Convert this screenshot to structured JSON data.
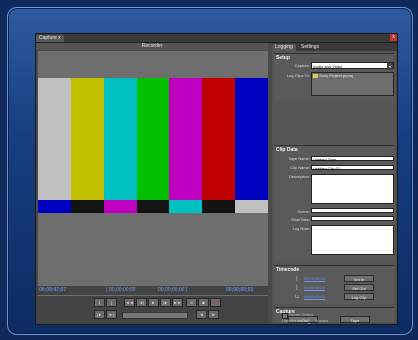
{
  "window": {
    "close_glyph": "x"
  },
  "tabs": {
    "capture_label": "Capture",
    "capture_close": "x"
  },
  "monitor": {
    "title": "Recorder",
    "color_bars_top": [
      "#c0c0c0",
      "#c0c000",
      "#00c0c0",
      "#00c000",
      "#c000c0",
      "#c00000",
      "#0000c0"
    ],
    "color_bars_mid": [
      "#0000c0",
      "#131313",
      "#c000c0",
      "#131313",
      "#00c0c0",
      "#131313",
      "#c0c0c0"
    ],
    "color_bars_low": [
      "#1f1150",
      "#ffffff",
      "#0c1f44",
      "#131313",
      "#131313",
      "#131313",
      "#131313"
    ]
  },
  "timecodes": {
    "current": "00;00;47;07",
    "in": "{ 00;00;00;00",
    "out": "00;00;00;00 }",
    "duration": "00;00;00;01"
  },
  "transport": {
    "row1": [
      "{",
      "}",
      "◄◄",
      "◄|",
      "►",
      "|►",
      "►►",
      "II",
      "■",
      "●"
    ],
    "row2": [
      "{►",
      "►}",
      "◄",
      "►"
    ]
  },
  "logging": {
    "tab_logging": "Logging",
    "tab_settings": "Settings",
    "setup": {
      "header": "Setup",
      "capture_label": "Capture:",
      "capture_value": "Audio and Video",
      "log_clips_label": "Log Clips To:",
      "log_clips_value": "Sony Project.prproj"
    },
    "clip_data": {
      "header": "Clip Data",
      "tape_name_label": "Tape Name:",
      "tape_name_value": "Untitled Tape",
      "clip_name_label": "Clip Name:",
      "clip_name_value": "Untitled Clip 01",
      "description_label": "Description:",
      "scene_label": "Scene:",
      "shot_take_label": "Shot/Take:",
      "log_note_label": "Log Note:"
    },
    "timecode": {
      "header": "Timecode",
      "in_value": "00;00;00;00",
      "out_value": "00;00;00;00",
      "dur_value": "00;00;00;01",
      "set_in": "Set In",
      "set_out": "Set Out",
      "log_clip": "Log Clip"
    },
    "capture": {
      "header": "Capture",
      "in_out_btn": "In/Out",
      "tape_btn": "Tape",
      "scene_detect": "Scene Detect",
      "handles_label": "Handles:",
      "handles_value": "0",
      "frames_label": "frames"
    }
  }
}
